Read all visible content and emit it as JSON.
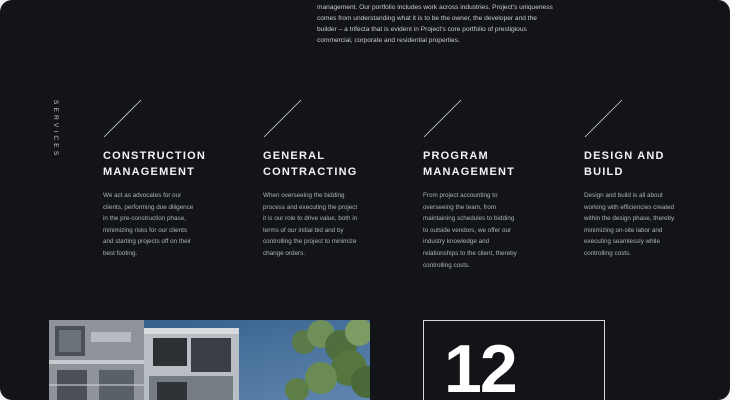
{
  "intro": {
    "lines": [
      "management. Our portfolio includes work across industries. Project's uniqueness",
      "comes from understanding what it is to be the owner, the developer and the",
      "builder – a trifecta that is evident in Project's core portfolio of prestigious",
      "commercial, corporate and residential properties."
    ]
  },
  "services_label": "SERVICES",
  "services": [
    {
      "title_lines": [
        "CONSTRUCTION",
        "MANAGEMENT"
      ],
      "desc_lines": [
        "We act as advocates for our",
        "clients, performing due diligence",
        "in the pre-construction phase,",
        "minimizing risks for our clients",
        "and starting projects off on their",
        "best footing."
      ]
    },
    {
      "title_lines": [
        "GENERAL",
        "CONTRACTING"
      ],
      "desc_lines": [
        "When overseeing the bidding",
        "process and executing the project",
        "it is our role to drive value, both in",
        "terms of our initial bid and by",
        "controlling the project to minimize",
        "change orders."
      ]
    },
    {
      "title_lines": [
        "PROGRAM",
        "MANAGEMENT"
      ],
      "desc_lines": [
        "From project accounting to",
        "overseeing the team, from",
        "maintaining schedules to bidding",
        "to outside vendors, we offer our",
        "industry knowledge and",
        "relationships to the client, thereby",
        "controlling costs."
      ]
    },
    {
      "title_lines": [
        "DESIGN AND",
        "BUILD"
      ],
      "desc_lines": [
        "Design and build is all about",
        "working with efficiencies created",
        "within the design phase, thereby",
        "minimizing on-site labor and",
        "executing seamlessly while",
        "controlling costs."
      ]
    }
  ],
  "stat": {
    "number": "12"
  }
}
